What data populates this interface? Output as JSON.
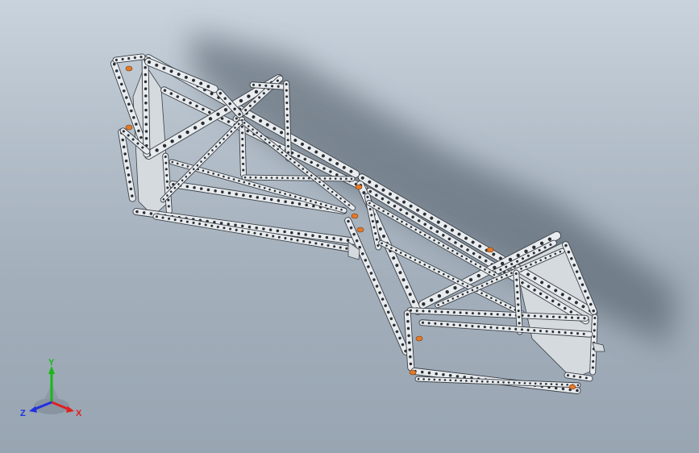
{
  "viewport": {
    "background_top": "#c9d3dd",
    "background_bottom": "#98a5b2"
  },
  "model": {
    "description_icon": "meccano-truss-frame",
    "colors": {
      "metal": "#e8ecef",
      "metal_dark": "#3b4047",
      "hole": "#2a2e33",
      "accent": "#e07a2c",
      "shadow": "#4a5561"
    }
  },
  "triad": {
    "x_label": "X",
    "y_label": "Y",
    "z_label": "Z",
    "x_color": "#e02020",
    "y_color": "#18b818",
    "z_color": "#2030e0"
  }
}
